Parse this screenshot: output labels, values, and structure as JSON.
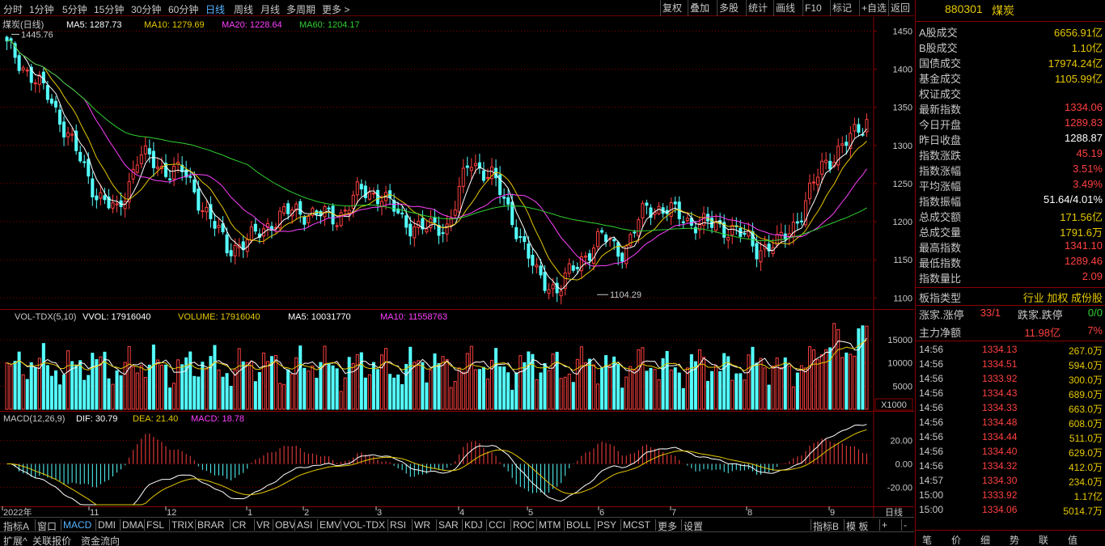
{
  "toolbar": {
    "periods": [
      "分时",
      "1分钟",
      "5分钟",
      "15分钟",
      "30分钟",
      "60分钟",
      "日线",
      "周线",
      "月线",
      "多周期",
      "更多 >"
    ],
    "active_period": "日线",
    "tools": [
      "复权",
      "叠加",
      "多股",
      "统计",
      "画线",
      "F10",
      "标记",
      "+自选",
      "返回"
    ]
  },
  "main_chart": {
    "title": "煤炭(日线)",
    "ma_labels": [
      {
        "text": "MA5: 1287.73",
        "color": "#ffffff"
      },
      {
        "text": "MA10: 1279.69",
        "color": "#e6c800"
      },
      {
        "text": "MA20: 1228.64",
        "color": "#ff40ff"
      },
      {
        "text": "MA60: 1204.17",
        "color": "#30d030"
      }
    ],
    "high_marker": "1445.76",
    "low_marker": "1104.29",
    "y_ticks": [
      "1450",
      "1400",
      "1350",
      "1300",
      "1250",
      "1200",
      "1150",
      "1100"
    ],
    "y_range": [
      1095,
      1460
    ]
  },
  "volume_chart": {
    "labels": [
      {
        "text": "VOL-TDX(5,10)",
        "color": "#c8c8c8"
      },
      {
        "text": "VVOL: 17916040",
        "color": "#ffffff"
      },
      {
        "text": "VOLUME: 17916040",
        "color": "#e6c800"
      },
      {
        "text": "MA5: 10031770",
        "color": "#ffffff"
      },
      {
        "text": "MA10: 11558763",
        "color": "#ff40ff"
      }
    ],
    "y_ticks": [
      "15000",
      "10000",
      "5000"
    ],
    "unit": "X1000"
  },
  "macd_chart": {
    "labels": [
      {
        "text": "MACD(12,26,9)",
        "color": "#c8c8c8"
      },
      {
        "text": "DIF: 30.79",
        "color": "#ffffff"
      },
      {
        "text": "DEA: 21.40",
        "color": "#e6c800"
      },
      {
        "text": "MACD: 18.78",
        "color": "#ff40ff"
      }
    ],
    "y_ticks": [
      "20.00",
      "0.00",
      "-20.00"
    ]
  },
  "x_axis": {
    "labels": [
      "2022年",
      "11",
      "12",
      "1",
      "2",
      "3",
      "4",
      "5",
      "6",
      "7",
      "8",
      "9"
    ],
    "period_label": "日线"
  },
  "indicator_tabs": [
    "指标A",
    "窗口",
    "MACD",
    "DMI",
    "DMA",
    "FSL",
    "TRIX",
    "BRAR",
    "CR",
    "VR",
    "OBV",
    "ASI",
    "EMV",
    "VOL-TDX",
    "RSI",
    "WR",
    "SAR",
    "KDJ",
    "CCI",
    "ROC",
    "MTM",
    "BOLL",
    "PSY",
    "MCST",
    "更多",
    "设置",
    "指标B",
    "模 板",
    "+",
    "-"
  ],
  "active_indicator": "MACD",
  "bottom_tabs": [
    "扩展^",
    "关联报价",
    "资金流向"
  ],
  "panel": {
    "code": "880301",
    "name": "煤炭",
    "rows": [
      {
        "label": "A股成交",
        "value": "6656.91亿",
        "color": "#e6c800"
      },
      {
        "label": "B股成交",
        "value": "1.10亿",
        "color": "#e6c800"
      },
      {
        "label": "国债成交",
        "value": "17974.24亿",
        "color": "#e6c800"
      },
      {
        "label": "基金成交",
        "value": "1105.99亿",
        "color": "#e6c800"
      },
      {
        "label": "权证成交",
        "value": "",
        "color": "#e6c800"
      },
      {
        "label": "最新指数",
        "value": "1334.06",
        "color": "#ff4040"
      },
      {
        "label": "今日开盘",
        "value": "1289.83",
        "color": "#ff4040"
      },
      {
        "label": "昨日收盘",
        "value": "1288.87",
        "color": "#ffffff"
      },
      {
        "label": "指数涨跌",
        "value": "45.19",
        "color": "#ff4040"
      },
      {
        "label": "指数涨幅",
        "value": "3.51%",
        "color": "#ff4040"
      },
      {
        "label": "平均涨幅",
        "value": "3.49%",
        "color": "#ff4040"
      },
      {
        "label": "指数振幅",
        "value": "51.64/4.01%",
        "color": "#ffffff"
      },
      {
        "label": "总成交额",
        "value": "171.56亿",
        "color": "#e6c800"
      },
      {
        "label": "总成交量",
        "value": "1791.6万",
        "color": "#e6c800"
      },
      {
        "label": "最高指数",
        "value": "1341.10",
        "color": "#ff4040"
      },
      {
        "label": "最低指数",
        "value": "1289.46",
        "color": "#ff4040"
      },
      {
        "label": "指数量比",
        "value": "2.09",
        "color": "#ff4040"
      }
    ],
    "board_type_label": "板指类型",
    "board_type_value": "行业 加权 成份股",
    "up_label": "涨家.涨停",
    "up_value": "33/1",
    "down_label": "跌家.跌停",
    "down_value": "0/0",
    "main_flow_label": "主力净额",
    "main_flow_value": "11.98亿",
    "main_flow_pct": "7%",
    "ticks": [
      {
        "time": "14:56",
        "price": "1334.13",
        "vol": "267.0万"
      },
      {
        "time": "14:56",
        "price": "1334.51",
        "vol": "594.0万"
      },
      {
        "time": "14:56",
        "price": "1333.92",
        "vol": "300.0万"
      },
      {
        "time": "14:56",
        "price": "1334.43",
        "vol": "689.0万"
      },
      {
        "time": "14:56",
        "price": "1334.33",
        "vol": "663.0万"
      },
      {
        "time": "14:56",
        "price": "1334.48",
        "vol": "608.0万"
      },
      {
        "time": "14:56",
        "price": "1334.44",
        "vol": "511.0万"
      },
      {
        "time": "14:56",
        "price": "1334.40",
        "vol": "629.0万"
      },
      {
        "time": "14:56",
        "price": "1334.32",
        "vol": "412.0万"
      },
      {
        "time": "14:57",
        "price": "1334.30",
        "vol": "234.0万"
      },
      {
        "time": "15:00",
        "price": "1333.92",
        "vol": "1.17亿"
      },
      {
        "time": "15:00",
        "price": "1334.06",
        "vol": "5014.7万"
      }
    ],
    "tabs": [
      "笔",
      "价",
      "细",
      "势",
      "联",
      "值"
    ]
  },
  "colors": {
    "up": "#ff4040",
    "down": "#54ffff",
    "grid": "#8a0000",
    "ma5": "#ffffff",
    "ma10": "#e6c800",
    "ma20": "#ff40ff",
    "ma60": "#30d030"
  },
  "chart_data": {
    "type": "candlestick",
    "title": "煤炭(日线)",
    "ohlc_sample_note": "",
    "y_range": [
      1095,
      1460
    ],
    "close_series_keypoints": [
      {
        "x": "2022-10",
        "close": 1430
      },
      {
        "x": "2022-10-mid",
        "close": 1360
      },
      {
        "x": "2022-11",
        "close": 1240
      },
      {
        "x": "2022-11-mid",
        "close": 1290
      },
      {
        "x": "2022-12",
        "close": 1265
      },
      {
        "x": "2022-12-end",
        "close": 1165
      },
      {
        "x": "2023-01",
        "close": 1200
      },
      {
        "x": "2023-02",
        "close": 1210
      },
      {
        "x": "2023-03",
        "close": 1240
      },
      {
        "x": "2023-04",
        "close": 1190
      },
      {
        "x": "2023-05",
        "close": 1280
      },
      {
        "x": "2023-06",
        "close": 1110
      },
      {
        "x": "2023-07",
        "close": 1220
      },
      {
        "x": "2023-08",
        "close": 1190
      },
      {
        "x": "2023-09",
        "close": 1334
      }
    ],
    "ma": {
      "MA5": 1287.73,
      "MA10": 1279.69,
      "MA20": 1228.64,
      "MA60": 1204.17
    },
    "high": 1445.76,
    "low": 1104.29,
    "volume": {
      "VVOL": 17916040,
      "VOLUME": 17916040,
      "MA5": 10031770,
      "MA10": 11558763,
      "unit": "X1000"
    },
    "macd": {
      "DIF": 30.79,
      "DEA": 21.4,
      "MACD": 18.78
    }
  }
}
